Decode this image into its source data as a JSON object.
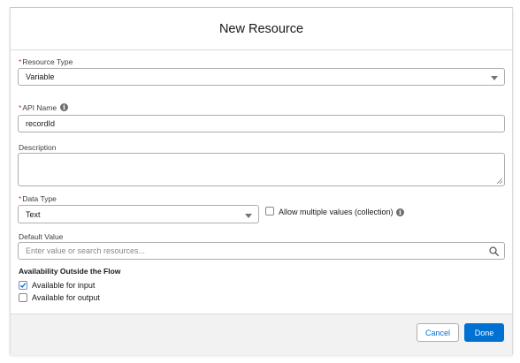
{
  "modal": {
    "title": "New Resource"
  },
  "resource_type": {
    "label": "Resource Type",
    "value": "Variable"
  },
  "api_name": {
    "label": "API Name",
    "value": "recordId",
    "info_icon": "info-icon"
  },
  "description": {
    "label": "Description",
    "value": ""
  },
  "data_type": {
    "label": "Data Type",
    "value": "Text"
  },
  "allow_multiple": {
    "label": "Allow multiple values (collection)",
    "checked": false,
    "info_icon": "info-icon"
  },
  "default_value": {
    "label": "Default Value",
    "placeholder": "Enter value or search resources...",
    "search_icon": "search-icon"
  },
  "availability": {
    "title": "Availability Outside the Flow",
    "input_label": "Available for input",
    "input_checked": true,
    "output_label": "Available for output",
    "output_checked": false
  },
  "footer": {
    "cancel_label": "Cancel",
    "done_label": "Done"
  },
  "colors": {
    "brand": "#0070d2",
    "required": "#c23934",
    "footer_bg": "#f3f2f2"
  }
}
